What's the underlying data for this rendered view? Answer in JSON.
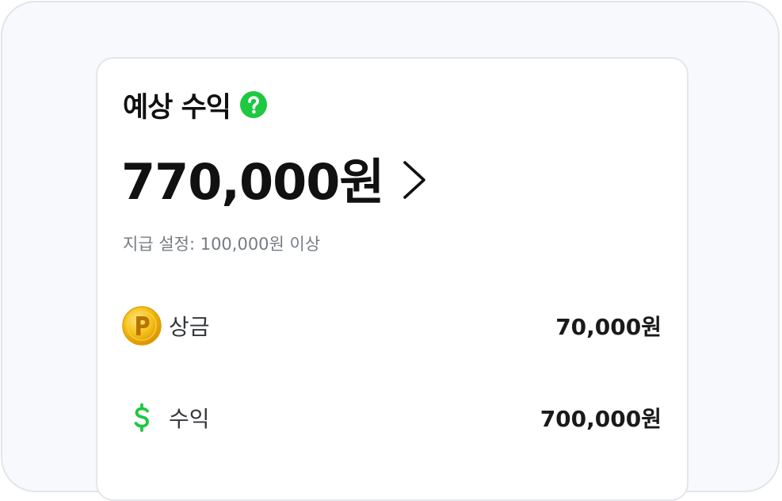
{
  "earnings": {
    "title": "예상 수익",
    "total_amount": "770,000원",
    "payout_setting": "지급 설정: 100,000원 이상",
    "items": [
      {
        "icon": "point-coin-icon",
        "label": "상금",
        "value": "70,000원"
      },
      {
        "icon": "dollar-icon",
        "label": "수익",
        "value": "700,000원"
      }
    ]
  },
  "colors": {
    "accent_green": "#1ec840",
    "coin_gold": "#f2b705",
    "text_primary": "#111111",
    "text_secondary": "#777c83"
  }
}
